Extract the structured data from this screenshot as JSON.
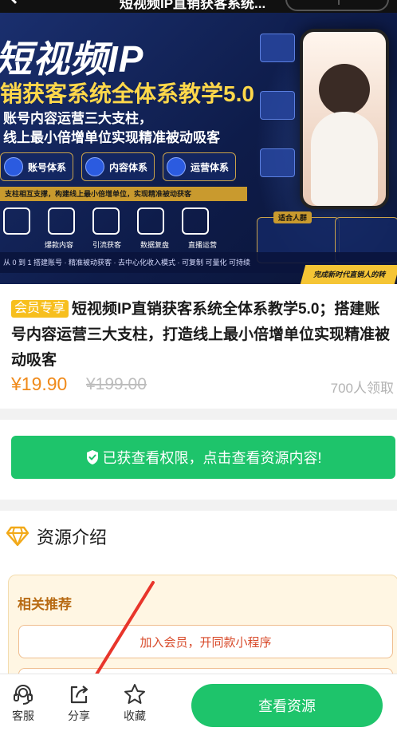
{
  "header": {
    "title": "短视频IP直销获客系统..."
  },
  "banner": {
    "title_line1": "短视频IP",
    "title_line2": "销获客系统全体系教学5.0",
    "subtitle_line1": "账号内容运营三大支柱，",
    "subtitle_line2": "线上最小倍增单位实现精准被动吸客",
    "pillars": [
      "账号体系",
      "内容体系",
      "运营体系"
    ],
    "strip_text": "支柱相互支撑，构建线上最小倍增单位，实现精准被动获客",
    "icon_labels": [
      "",
      "爆款内容",
      "引流获客",
      "数据复盘",
      "直播运营"
    ],
    "bottom_strip_text": "从 0 到 1 搭建账号 · 精准被动获客 · 去中心化收入模式 · 可复制 可量化 可持续",
    "audience_title": "适合人群",
    "badge_text": "完成新时代直销人的转"
  },
  "product": {
    "vip_tag": "会员专享",
    "title": "短视频IP直销获客系统全体系教学5.0；搭建账号内容运营三大支柱，打造线上最小倍增单位实现精准被动吸客",
    "price": "¥19.90",
    "original_price": "¥199.00",
    "claim_count": "700人领取"
  },
  "access": {
    "button_label": "已获查看权限，点击查看资源内容!"
  },
  "intro": {
    "heading": "资源介绍",
    "related_label": "相关推荐",
    "items": [
      "加入会员，开同款小程序",
      ""
    ]
  },
  "bottom_bar": {
    "service_label": "客服",
    "share_label": "分享",
    "favorite_label": "收藏",
    "cta_label": "查看资源"
  },
  "colors": {
    "accent_green": "#1ec46b",
    "price_orange": "#f08a1a",
    "vip_yellow": "#f7bf1d",
    "annotation_red": "#e8352b"
  }
}
